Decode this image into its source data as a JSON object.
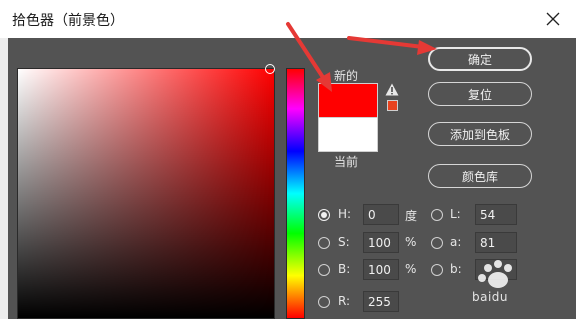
{
  "window": {
    "title": "拾色器（前景色）",
    "close_icon": "close-icon"
  },
  "preview": {
    "new_label": "新的",
    "current_label": "当前",
    "new_color": "#ff0000",
    "current_color": "#ffffff",
    "gamut_color": "#e8431f"
  },
  "buttons": {
    "ok": "确定",
    "reset": "复位",
    "add_to_swatches": "添加到色板",
    "color_libraries": "颜色库"
  },
  "fields": {
    "h": {
      "label": "H:",
      "value": "0",
      "unit": "度"
    },
    "s": {
      "label": "S:",
      "value": "100",
      "unit": "%"
    },
    "b": {
      "label": "B:",
      "value": "100",
      "unit": "%"
    },
    "r": {
      "label": "R:",
      "value": "255"
    },
    "l": {
      "label": "L:",
      "value": "54"
    },
    "a": {
      "label": "a:",
      "value": "81"
    },
    "bb": {
      "label": "b:",
      "value": ""
    }
  },
  "colors": {
    "panel": "#535353",
    "annotation_arrow": "#e53935"
  },
  "watermark": "baidu"
}
